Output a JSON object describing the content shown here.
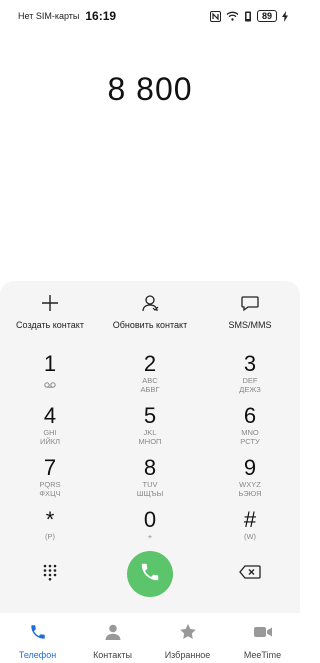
{
  "status_bar": {
    "carrier": "Нет SIM-карты",
    "time": "16:19",
    "battery": "89",
    "icons": [
      "nfc-icon",
      "wifi-icon",
      "vibrate-icon",
      "battery-icon",
      "charging-icon"
    ]
  },
  "display": {
    "number": "8 800"
  },
  "actions": [
    {
      "label": "Создать контакт",
      "icon": "plus-icon"
    },
    {
      "label": "Обновить контакт",
      "icon": "person-icon"
    },
    {
      "label": "SMS/MMS",
      "icon": "chat-bubble-icon"
    }
  ],
  "keys": [
    {
      "digit": "1",
      "sub": "",
      "sub2": "",
      "icon": "voicemail-icon"
    },
    {
      "digit": "2",
      "sub": "ABC",
      "sub2": "АБВГ"
    },
    {
      "digit": "3",
      "sub": "DEF",
      "sub2": "ДЕЖЗ"
    },
    {
      "digit": "4",
      "sub": "GHI",
      "sub2": "ИЙКЛ"
    },
    {
      "digit": "5",
      "sub": "JKL",
      "sub2": "МНОП"
    },
    {
      "digit": "6",
      "sub": "MNO",
      "sub2": "РСТУ"
    },
    {
      "digit": "7",
      "sub": "PQRS",
      "sub2": "ФХЦЧ"
    },
    {
      "digit": "8",
      "sub": "TUV",
      "sub2": "ШЩЪЫ"
    },
    {
      "digit": "9",
      "sub": "WXYZ",
      "sub2": "ЬЭЮЯ"
    },
    {
      "digit": "*",
      "sub": "(P)",
      "sub2": ""
    },
    {
      "digit": "0",
      "sub": "+",
      "sub2": ""
    },
    {
      "digit": "#",
      "sub": "(W)",
      "sub2": ""
    }
  ],
  "bottom_controls": {
    "left_icon": "dialpad-grid-icon",
    "center_icon": "phone-icon",
    "right_icon": "backspace-icon",
    "call_color": "#5cc46a"
  },
  "nav": [
    {
      "label": "Телефон",
      "icon": "phone-icon",
      "active": true
    },
    {
      "label": "Контакты",
      "icon": "contacts-icon",
      "active": false
    },
    {
      "label": "Избранное",
      "icon": "star-icon",
      "active": false
    },
    {
      "label": "MeeTime",
      "icon": "video-call-icon",
      "active": false
    }
  ],
  "colors": {
    "accent": "#1f6fd8",
    "panel": "#f5f5f5"
  }
}
